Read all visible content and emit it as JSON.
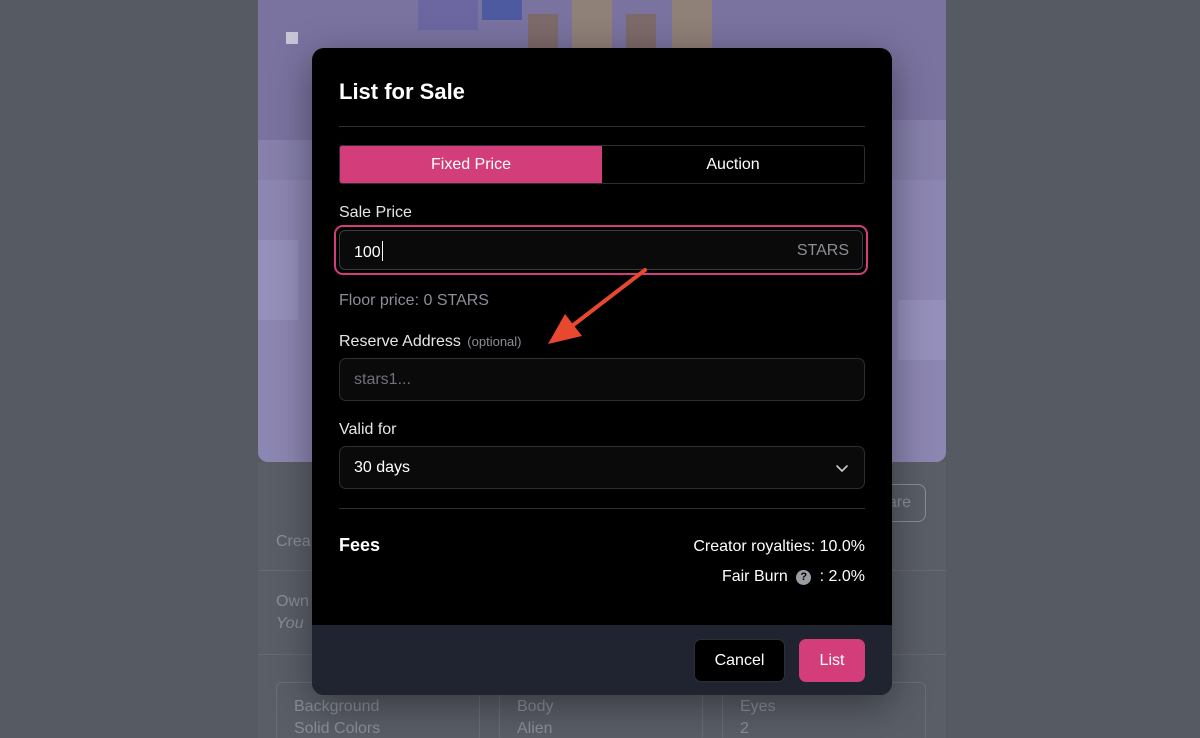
{
  "background": {
    "share_label": "are",
    "creator_label": "Crea",
    "owner_label": "Own",
    "owner_value": "You",
    "traits": [
      {
        "label": "Background",
        "value": "Solid Colors"
      },
      {
        "label": "Body",
        "value": "Alien"
      },
      {
        "label": "Eyes",
        "value": "2"
      }
    ]
  },
  "modal": {
    "title": "List for Sale",
    "tabs": [
      {
        "label": "Fixed Price",
        "active": true
      },
      {
        "label": "Auction",
        "active": false
      }
    ],
    "sale_price": {
      "label": "Sale Price",
      "value": "100",
      "unit": "STARS"
    },
    "floor_price": "Floor price: 0 STARS",
    "reserve_address": {
      "label": "Reserve Address",
      "optional": "(optional)",
      "placeholder": "stars1..."
    },
    "valid_for": {
      "label": "Valid for",
      "value": "30 days"
    },
    "fees": {
      "title": "Fees",
      "creator_royalties": "Creator royalties: 10.0%",
      "fair_burn_label": "Fair Burn",
      "fair_burn_value": ": 2.0%"
    },
    "footer": {
      "cancel_label": "Cancel",
      "list_label": "List"
    }
  },
  "colors": {
    "accent": "#d23d7a",
    "annotation_arrow": "#e8482f"
  },
  "icons": [
    "help-icon",
    "chevron-down-icon",
    "annotation-arrow"
  ]
}
